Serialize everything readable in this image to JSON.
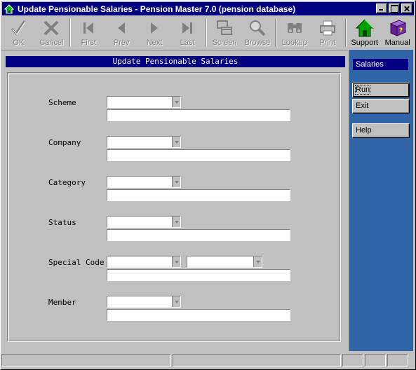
{
  "window": {
    "title": "Update Pensionable Salaries - Pension Master 7.0 (pension database)"
  },
  "toolbar": {
    "items": [
      {
        "label": "OK",
        "icon": "check-icon",
        "enabled": false
      },
      {
        "label": "Cancel",
        "icon": "x-icon",
        "enabled": false
      },
      {
        "label": "First",
        "icon": "first-icon",
        "enabled": false
      },
      {
        "label": "Prev",
        "icon": "prev-icon",
        "enabled": false
      },
      {
        "label": "Next",
        "icon": "next-icon",
        "enabled": false
      },
      {
        "label": "Last",
        "icon": "last-icon",
        "enabled": false
      },
      {
        "label": "Screen",
        "icon": "screen-icon",
        "enabled": false
      },
      {
        "label": "Browse",
        "icon": "magnifier-icon",
        "enabled": false
      },
      {
        "label": "Lookup",
        "icon": "binoculars-icon",
        "enabled": false
      },
      {
        "label": "Print",
        "icon": "printer-icon",
        "enabled": false
      },
      {
        "label": "Support",
        "icon": "house-icon",
        "enabled": true
      },
      {
        "label": "Manual",
        "icon": "book-icon",
        "enabled": true
      }
    ]
  },
  "panel": {
    "header": "Update Pensionable Salaries"
  },
  "form": {
    "fields": [
      {
        "label": "Scheme",
        "combo_value": "",
        "text_value": ""
      },
      {
        "label": "Company",
        "combo_value": "",
        "text_value": ""
      },
      {
        "label": "Category",
        "combo_value": "",
        "text_value": ""
      },
      {
        "label": "Status",
        "combo_value": "",
        "text_value": ""
      },
      {
        "label": "Special Code",
        "combo_value": "",
        "combo2_value": "",
        "text_value": ""
      },
      {
        "label": "Member",
        "combo_value": "",
        "text_value": ""
      }
    ]
  },
  "side": {
    "title": "Salaries",
    "buttons": {
      "run": "Run",
      "exit": "Exit",
      "help": "Help"
    }
  },
  "colors": {
    "title_bar": "#000080",
    "side_panel": "#3066a8",
    "support_icon": "#00a000",
    "manual_icon": "#7030a0"
  }
}
